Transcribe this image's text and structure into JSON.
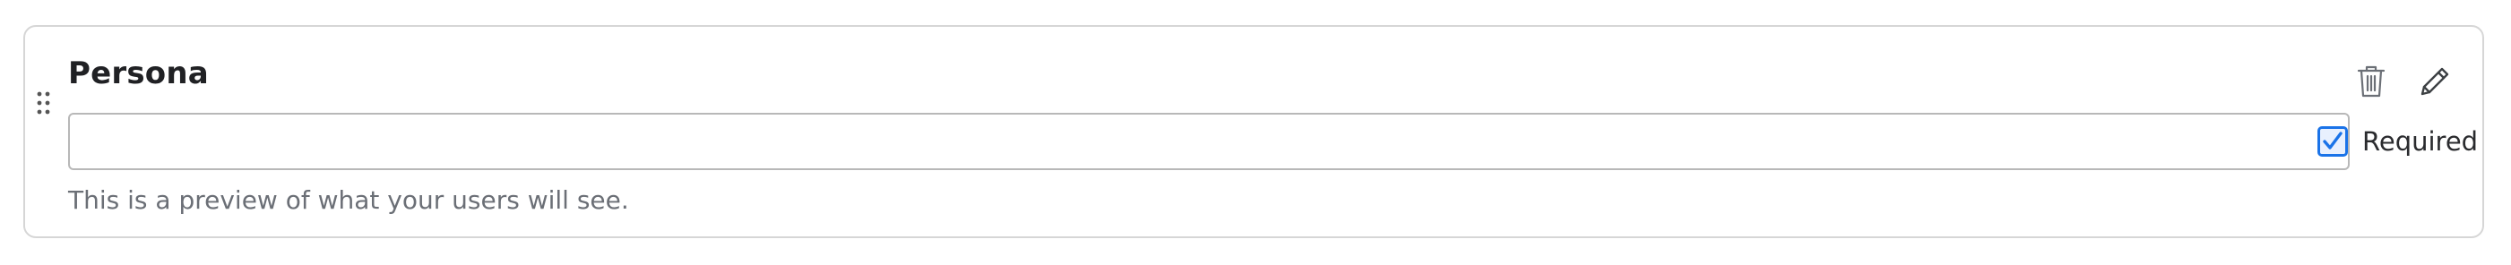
{
  "field": {
    "title": "Persona",
    "input_value": "",
    "input_placeholder": "",
    "helper_text": "This is a preview of what your users will see."
  },
  "required": {
    "label": "Required",
    "checked": true
  },
  "icons": {
    "drag": "drag-handle-icon",
    "delete": "trash-icon",
    "edit": "pencil-icon",
    "check": "checkmark-icon"
  },
  "colors": {
    "checkbox_accent": "#1a73e8",
    "border": "#d6d6d6",
    "helper_text": "#6b6f76",
    "icon": "#5f6368"
  }
}
